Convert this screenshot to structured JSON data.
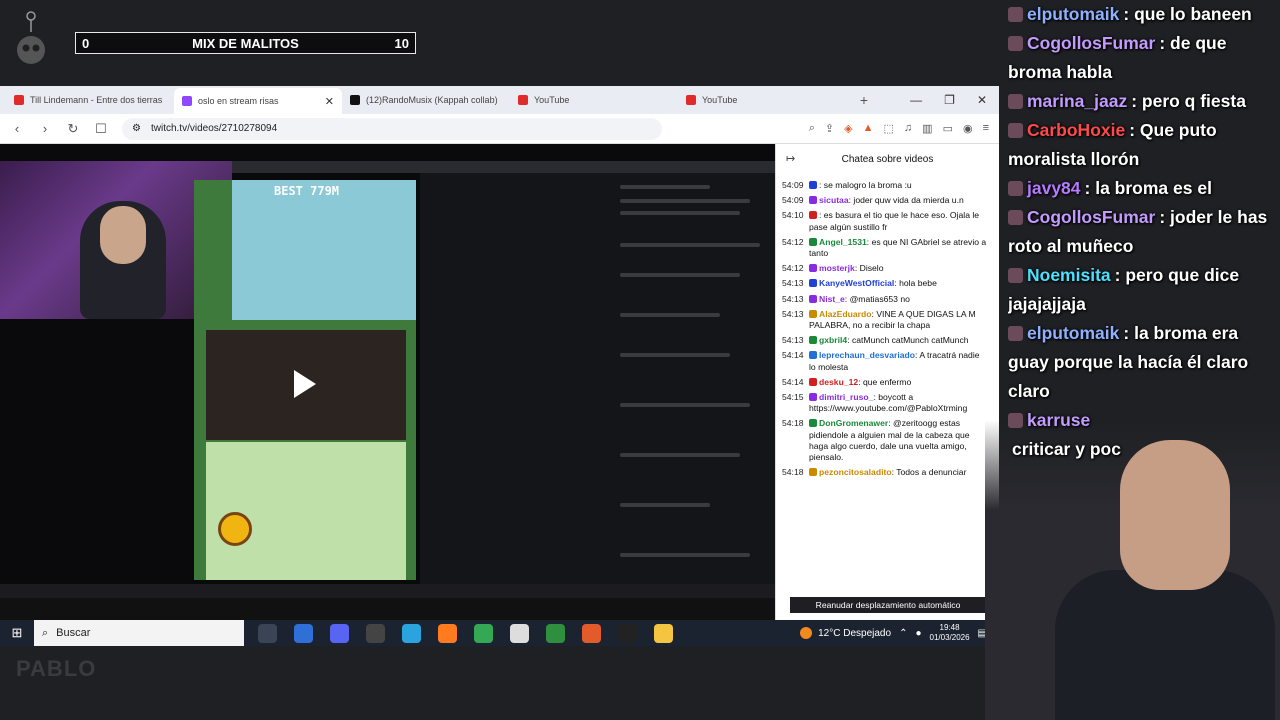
{
  "overlay": {
    "score_left": "0",
    "title": "MIX DE MALITOS",
    "score_right": "10",
    "brand": "PABLO"
  },
  "browser": {
    "tabs": [
      {
        "label": "Till Lindemann - Entre dos tierras",
        "color": "#e02b2b"
      },
      {
        "label": "oslo en stream risas",
        "color": "#9146ff"
      },
      {
        "label": "(12)RandoMusix (Kappah collab)",
        "color": "#111111"
      },
      {
        "label": "YouTube",
        "color": "#e02b2b"
      },
      {
        "label": "YouTube",
        "color": "#e02b2b"
      }
    ],
    "url": "twitch.tv/videos/2710278094"
  },
  "game": {
    "best": "BEST 779M"
  },
  "chat_panel": {
    "title": "Chatea sobre videos",
    "resume": "Reanudar desplazamiento automático",
    "messages": [
      {
        "time": "54:09",
        "user": "",
        "color": "#1f3fd6",
        "text": "se malogro la broma :u"
      },
      {
        "time": "54:09",
        "user": "sicutaa",
        "color": "#8a2be2",
        "text": "joder quw vida da mierda u.n"
      },
      {
        "time": "54:10",
        "user": "",
        "color": "#d02020",
        "text": "es basura el tio que le hace eso. Ojala le pase algún sustillo fr"
      },
      {
        "time": "54:12",
        "user": "Angel_1531",
        "color": "#1a8a3a",
        "text": "es que NI GAbriel se atrevio a tanto"
      },
      {
        "time": "54:12",
        "user": "mosterjk",
        "color": "#8a2be2",
        "text": "Diselo"
      },
      {
        "time": "54:13",
        "user": "KanyeWestOfficial",
        "color": "#1f3fd6",
        "text": "hola bebe"
      },
      {
        "time": "54:13",
        "user": "Nist_e",
        "color": "#8a2be2",
        "text": "@matias653 no"
      },
      {
        "time": "54:13",
        "user": "AlazEduardo",
        "color": "#c98a00",
        "text": "VINE A QUE DIGAS LA M PALABRA, no a recibir la chapa"
      },
      {
        "time": "54:13",
        "user": "gxbril4",
        "color": "#1a8a3a",
        "text": "catMunch catMunch catMunch"
      },
      {
        "time": "54:14",
        "user": "leprechaun_desvariado",
        "color": "#1f6fd6",
        "text": "A tracatrá nadie lo molesta"
      },
      {
        "time": "54:14",
        "user": "desku_12",
        "color": "#d02020",
        "text": "que enfermo"
      },
      {
        "time": "54:15",
        "user": "dimitri_ruso_",
        "color": "#8a2be2",
        "text": "boycott a https://www.youtube.com/@PabloXtrming"
      },
      {
        "time": "54:18",
        "user": "DonGromenawer",
        "color": "#1a8a3a",
        "text": "@zeritoogg estas pidiendole a alguien mal de la cabeza que haga algo cuerdo, dale una vuelta amigo, piensalo."
      },
      {
        "time": "54:18",
        "user": "pezoncitosaladito",
        "color": "#c98a00",
        "text": "Todos a denunciar"
      }
    ]
  },
  "taskbar": {
    "search_placeholder": "Buscar",
    "weather": "12°C  Despejado",
    "time": "19:48",
    "date": "01/03/2026"
  },
  "stream_chat": [
    {
      "user": "elputomaik",
      "color": "#8fb0ff",
      "text": ": que lo baneen"
    },
    {
      "user": "CogollosFumar",
      "color": "#c39bff",
      "text": ": de que broma habla"
    },
    {
      "user": "marina_jaaz",
      "color": "#c39bff",
      "text": ": pero q fiesta"
    },
    {
      "user": "CarboHoxie",
      "color": "#ff4a4a",
      "text": ": Que puto moralista llorón"
    },
    {
      "user": "javy84",
      "color": "#b57aff",
      "text": ": la broma es el"
    },
    {
      "user": "CogollosFumar",
      "color": "#c39bff",
      "text": ": joder le has roto al muñeco"
    },
    {
      "user": "Noemisita",
      "color": "#4ae0ff",
      "text": ": pero que dice jajajajjaja"
    },
    {
      "user": "elputomaik",
      "color": "#8fb0ff",
      "text": ": la broma era guay porque la hacía él claro claro"
    },
    {
      "user": "karruse",
      "color": "#c39bff",
      "text": ""
    },
    {
      "user": "",
      "color": "#ffffff",
      "text": "criticar y poc"
    }
  ]
}
